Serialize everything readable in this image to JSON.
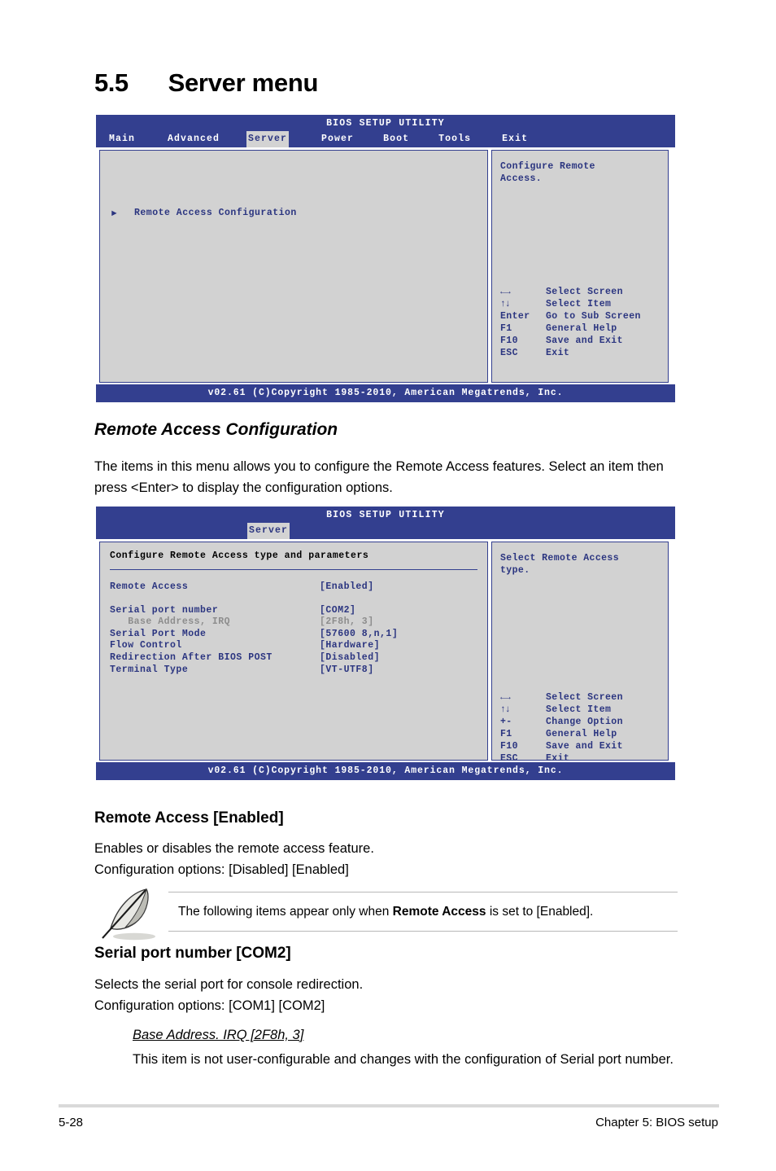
{
  "section": {
    "number": "5.5",
    "title": "Server menu"
  },
  "bios_screen_1": {
    "title": "BIOS SETUP UTILITY",
    "tabs": [
      "Main",
      "Advanced",
      "Server",
      "Power",
      "Boot",
      "Tools",
      "Exit"
    ],
    "active_tab": "Server",
    "menu_item": "Remote Access Configuration",
    "help_text": "Configure Remote\nAccess.",
    "legend": [
      {
        "key": "←→",
        "action": "Select Screen"
      },
      {
        "key": "↑↓",
        "action": "Select Item"
      },
      {
        "key": "Enter",
        "action": "Go to Sub Screen"
      },
      {
        "key": "F1",
        "action": "General Help"
      },
      {
        "key": "F10",
        "action": "Save and Exit"
      },
      {
        "key": "ESC",
        "action": "Exit"
      }
    ],
    "footer": "v02.61 (C)Copyright 1985-2010, American Megatrends, Inc."
  },
  "heading_remote_access_config": "Remote Access Configuration",
  "para_remote_access_config": "The items in this menu allows you to configure the Remote Access features. Select an item then press <Enter> to display the configuration options.",
  "bios_screen_2": {
    "title": "BIOS SETUP UTILITY",
    "active_tab": "Server",
    "section_title": "Configure Remote Access type and parameters",
    "rows": [
      {
        "label": "Remote Access",
        "value": "[Enabled]",
        "dim": false
      },
      {
        "label": "Serial port number",
        "value": "[COM2]",
        "dim": false
      },
      {
        "label": "   Base Address, IRQ",
        "value": "[2F8h, 3]",
        "dim": true
      },
      {
        "label": "Serial Port Mode",
        "value": "[57600 8,n,1]",
        "dim": false
      },
      {
        "label": "Flow Control",
        "value": "[Hardware]",
        "dim": false
      },
      {
        "label": "Redirection After BIOS POST",
        "value": "[Disabled]",
        "dim": false
      },
      {
        "label": "Terminal Type",
        "value": "[VT-UTF8]",
        "dim": false
      }
    ],
    "help_text": "Select Remote Access\ntype.",
    "legend": [
      {
        "key": "←→",
        "action": "Select Screen"
      },
      {
        "key": "↑↓",
        "action": "Select Item"
      },
      {
        "key": "+-",
        "action": "Change Option"
      },
      {
        "key": "F1",
        "action": "General Help"
      },
      {
        "key": "F10",
        "action": "Save and Exit"
      },
      {
        "key": "ESC",
        "action": "Exit"
      }
    ],
    "footer": "v02.61 (C)Copyright 1985-2010, American Megatrends, Inc."
  },
  "remote_access": {
    "heading": "Remote Access [Enabled]",
    "line1": "Enables or disables the remote access feature.",
    "line2": "Configuration options: [Disabled] [Enabled]"
  },
  "note": {
    "text_before": "The following items appear only when ",
    "text_bold": "Remote Access",
    "text_after": " is set to [Enabled]."
  },
  "serial_port": {
    "heading": "Serial port number [COM2]",
    "line1": "Selects the serial port for console redirection.",
    "line2": "Configuration options: [COM1] [COM2]",
    "sub_heading": "Base Address. IRQ [2F8h, 3]",
    "sub_text": "This item is not user-configurable and changes with the configuration of Serial port number."
  },
  "page_footer": {
    "page_number": "5-28",
    "chapter": "Chapter 5: BIOS setup"
  },
  "colors": {
    "bios_blue": "#333f8f",
    "bios_text_blue": "#2b3580",
    "panel_gray": "#d2d2d2",
    "tab_active_bg": "#d3d3d3",
    "dim_text": "#8d8d8d"
  }
}
